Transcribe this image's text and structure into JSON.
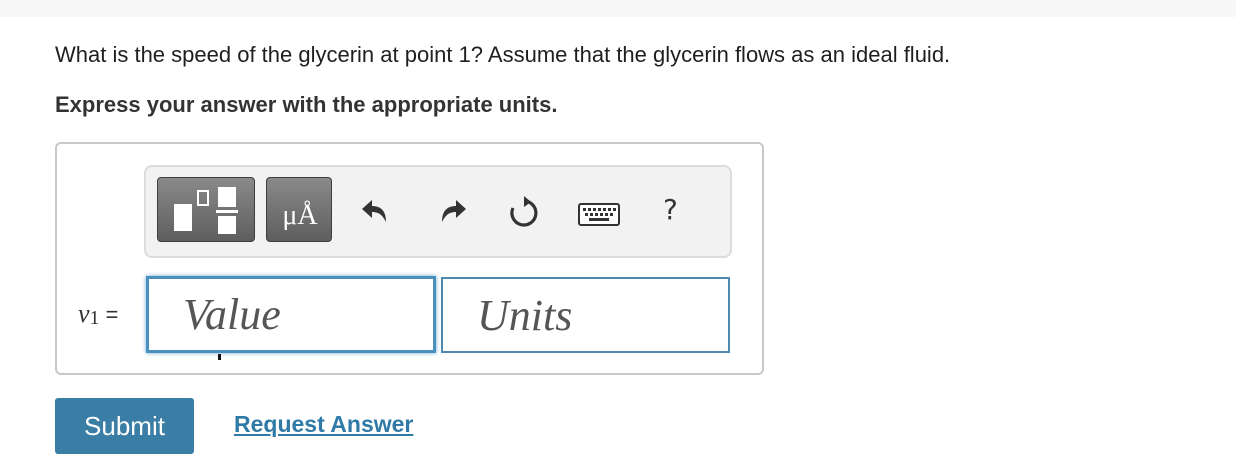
{
  "question": {
    "text": "What is the speed of the glycerin at point 1? Assume that the glycerin flows as an ideal fluid.",
    "instruction": "Express your answer with the appropriate units."
  },
  "toolbar": {
    "templates_icon": "fraction-templates-icon",
    "units_icon": "units-mu-angstrom-icon",
    "units_label": "μÅ",
    "undo_icon": "undo-icon",
    "redo_icon": "redo-icon",
    "reset_icon": "reset-icon",
    "keyboard_icon": "keyboard-icon",
    "help_label": "?"
  },
  "answer": {
    "variable": "v",
    "subscript": "1",
    "equals": "=",
    "value_placeholder": "Value",
    "units_placeholder": "Units"
  },
  "actions": {
    "submit_label": "Submit",
    "request_answer_label": "Request Answer"
  },
  "colors": {
    "accent": "#3a7ea5",
    "link": "#2f7aa6",
    "input_focus_border": "#4b8fbf",
    "toolbar_button": "#6e6e6e"
  }
}
